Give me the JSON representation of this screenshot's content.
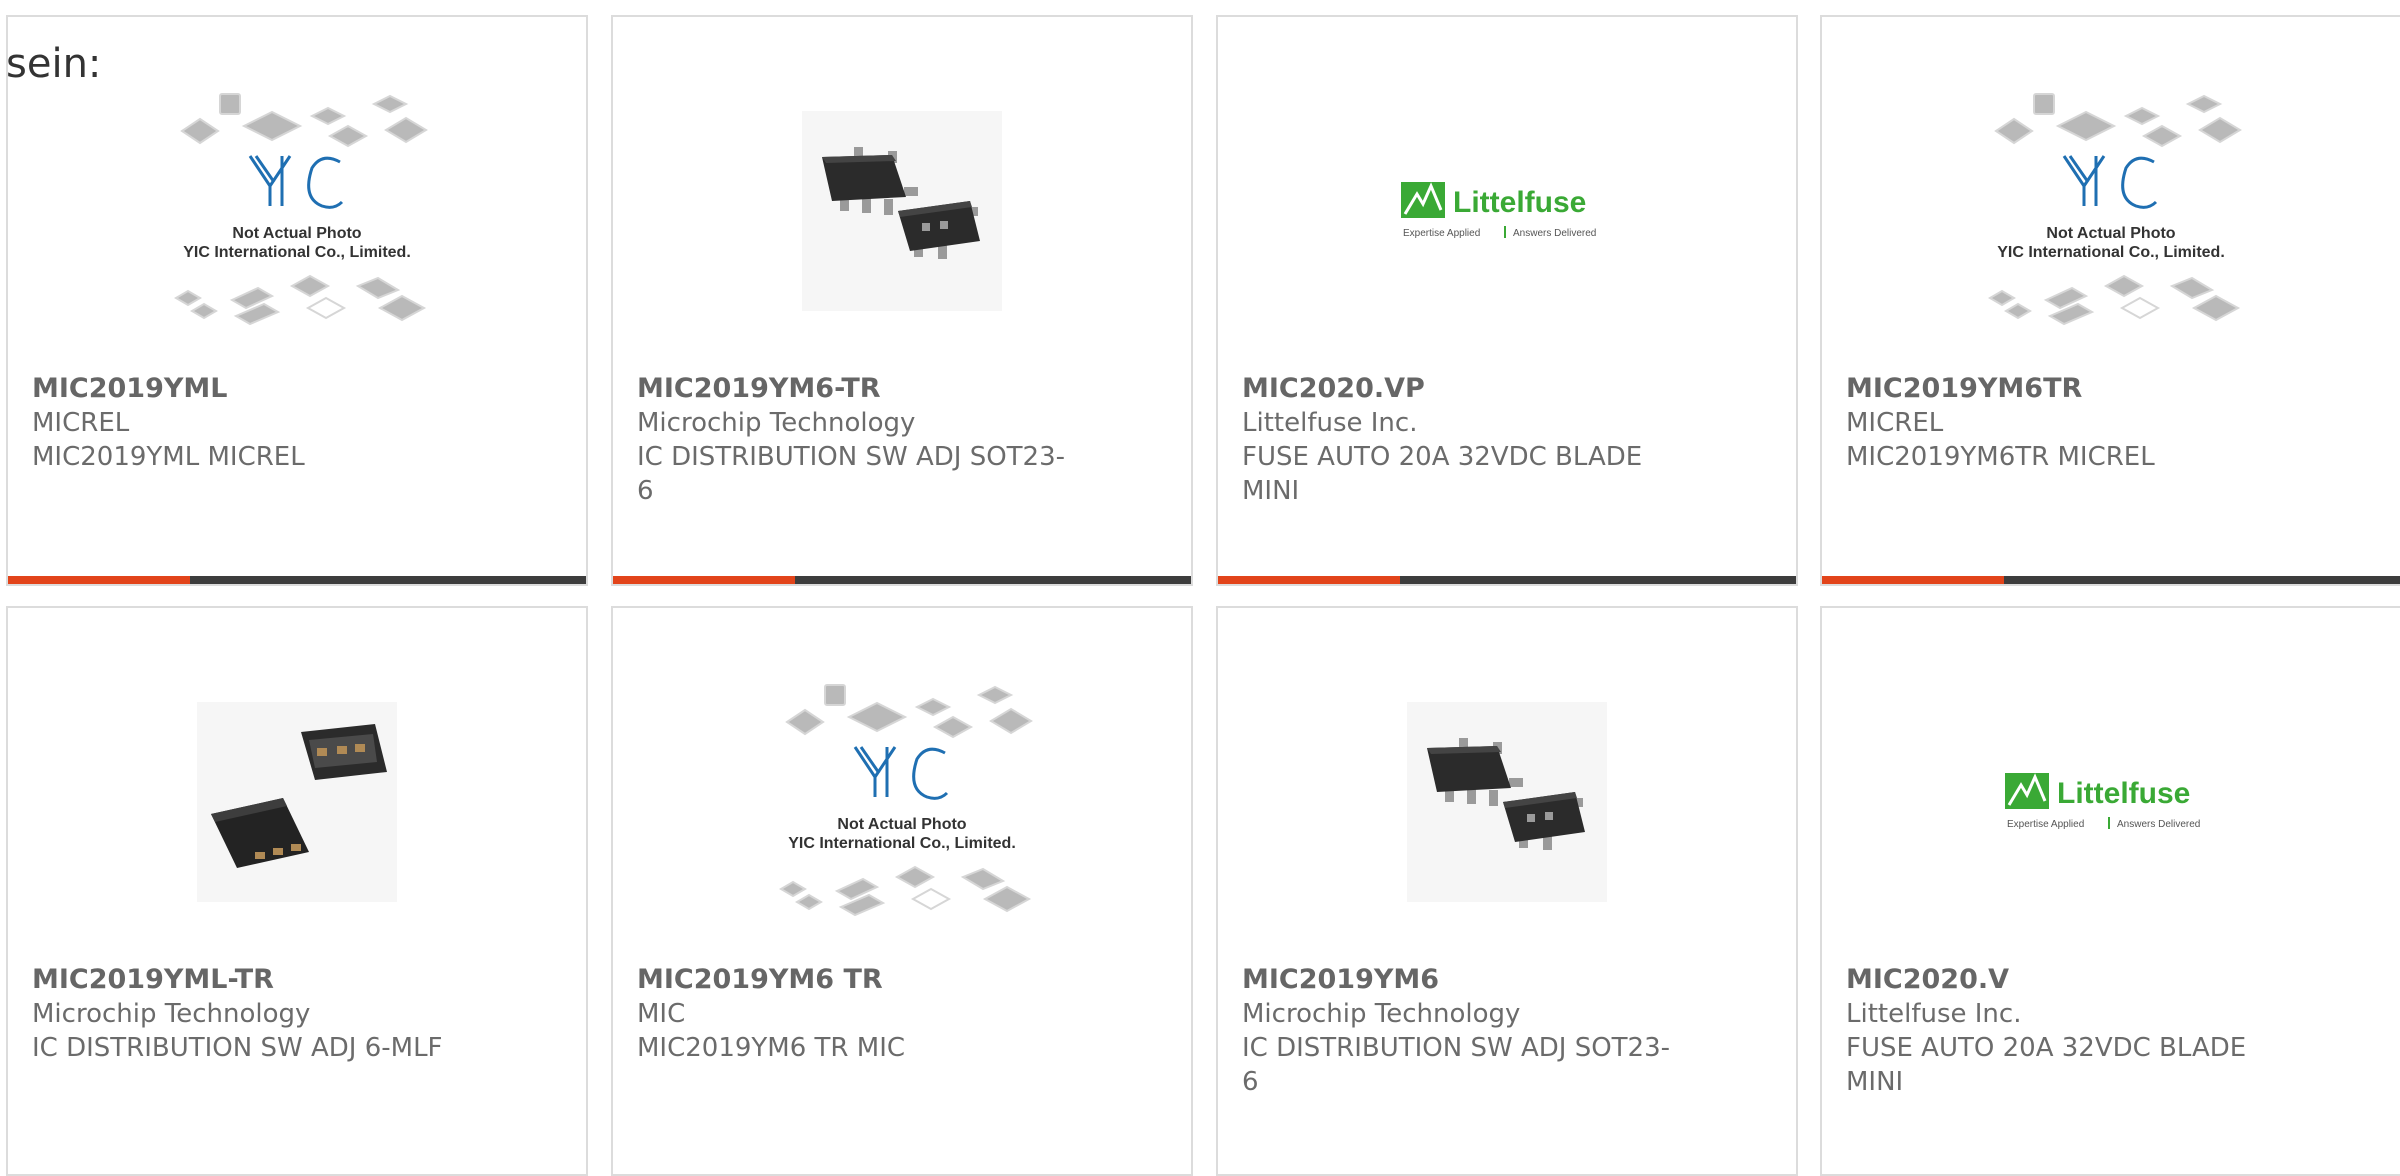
{
  "intro_text": "sein:",
  "placeholder": {
    "line1": "Not Actual Photo",
    "line2": "YIC International Co., Limited."
  },
  "littelfuse": {
    "name": "Littelfuse",
    "tagline1": "Expertise Applied",
    "tagline2": "Answers Delivered"
  },
  "colors": {
    "accent": "#e2441a",
    "bar": "#3d3d3d",
    "littelfuse_green": "#3aa935",
    "yic_blue": "#1f6fb2"
  },
  "products": [
    {
      "part": "MIC2019YML",
      "manufacturer": "MICREL",
      "description": "MIC2019YML MICREL",
      "image": "yic-placeholder-image"
    },
    {
      "part": "MIC2019YM6-TR",
      "manufacturer": "Microchip Technology",
      "description": "IC DISTRIBUTION SW ADJ SOT23-6",
      "image": "sot23-chip-image"
    },
    {
      "part": "MIC2020.VP",
      "manufacturer": "Littelfuse Inc.",
      "description": "FUSE AUTO 20A 32VDC BLADE MINI",
      "image": "littelfuse-logo"
    },
    {
      "part": "MIC2019YM6TR",
      "manufacturer": "MICREL",
      "description": "MIC2019YM6TR MICREL",
      "image": "yic-placeholder-image"
    },
    {
      "part": "MIC2019YML-TR",
      "manufacturer": "Microchip Technology",
      "description": "IC DISTRIBUTION SW ADJ 6-MLF",
      "image": "mlf-chip-image"
    },
    {
      "part": "MIC2019YM6 TR",
      "manufacturer": "MIC",
      "description": "MIC2019YM6 TR MIC",
      "image": "yic-placeholder-image"
    },
    {
      "part": "MIC2019YM6",
      "manufacturer": "Microchip Technology",
      "description": "IC DISTRIBUTION SW ADJ SOT23-6",
      "image": "sot23-chip-image"
    },
    {
      "part": "MIC2020.V",
      "manufacturer": "Littelfuse Inc.",
      "description": "FUSE AUTO 20A 32VDC BLADE MINI",
      "image": "littelfuse-logo"
    }
  ]
}
